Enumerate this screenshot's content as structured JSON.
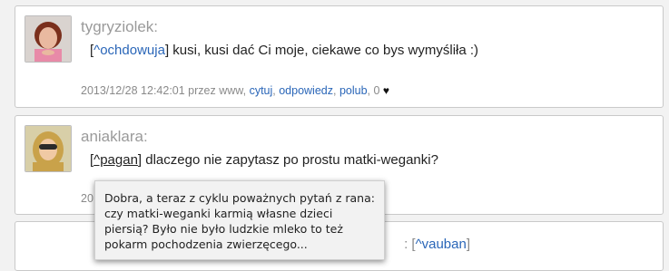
{
  "comments": [
    {
      "username": "tygryziolek:",
      "bracket_open": "[",
      "ref": "^ochdowuja",
      "bracket_close": "]",
      "text": " kusi, kusi dać Ci moje, ciekawe co bys wymyśliła :)",
      "meta": {
        "timestamp": "2013/12/28 12:42:01",
        "by": " przez www, ",
        "quote": "cytuj",
        "sep1": ", ",
        "reply": "odpowiedz",
        "sep2": ", ",
        "like": "polub",
        "likes_count": ", 0",
        "heart": "♥"
      }
    },
    {
      "username": "aniaklara:",
      "bracket_open": "[",
      "ref": "^pagan",
      "bracket_close": "]",
      "text": " dlaczego nie zapytasz po prostu matki-weganki?",
      "meta": {
        "timestamp_partial": "20"
      }
    },
    {
      "ref_suffix": ": [",
      "ref": "^vauban",
      "ref_close": "]"
    }
  ],
  "tooltip": {
    "text": "Dobra, a teraz z cyklu poważnych pytań z rana: czy matki-weganki karmią własne dzieci piersią? Było nie było ludzkie mleko to też pokarm pochodzenia zwierzęcego..."
  },
  "colors": {
    "link": "#2a66b8",
    "username": "#9a9a9a",
    "meta": "#8a8a8a",
    "background": "#f2f2f2"
  }
}
